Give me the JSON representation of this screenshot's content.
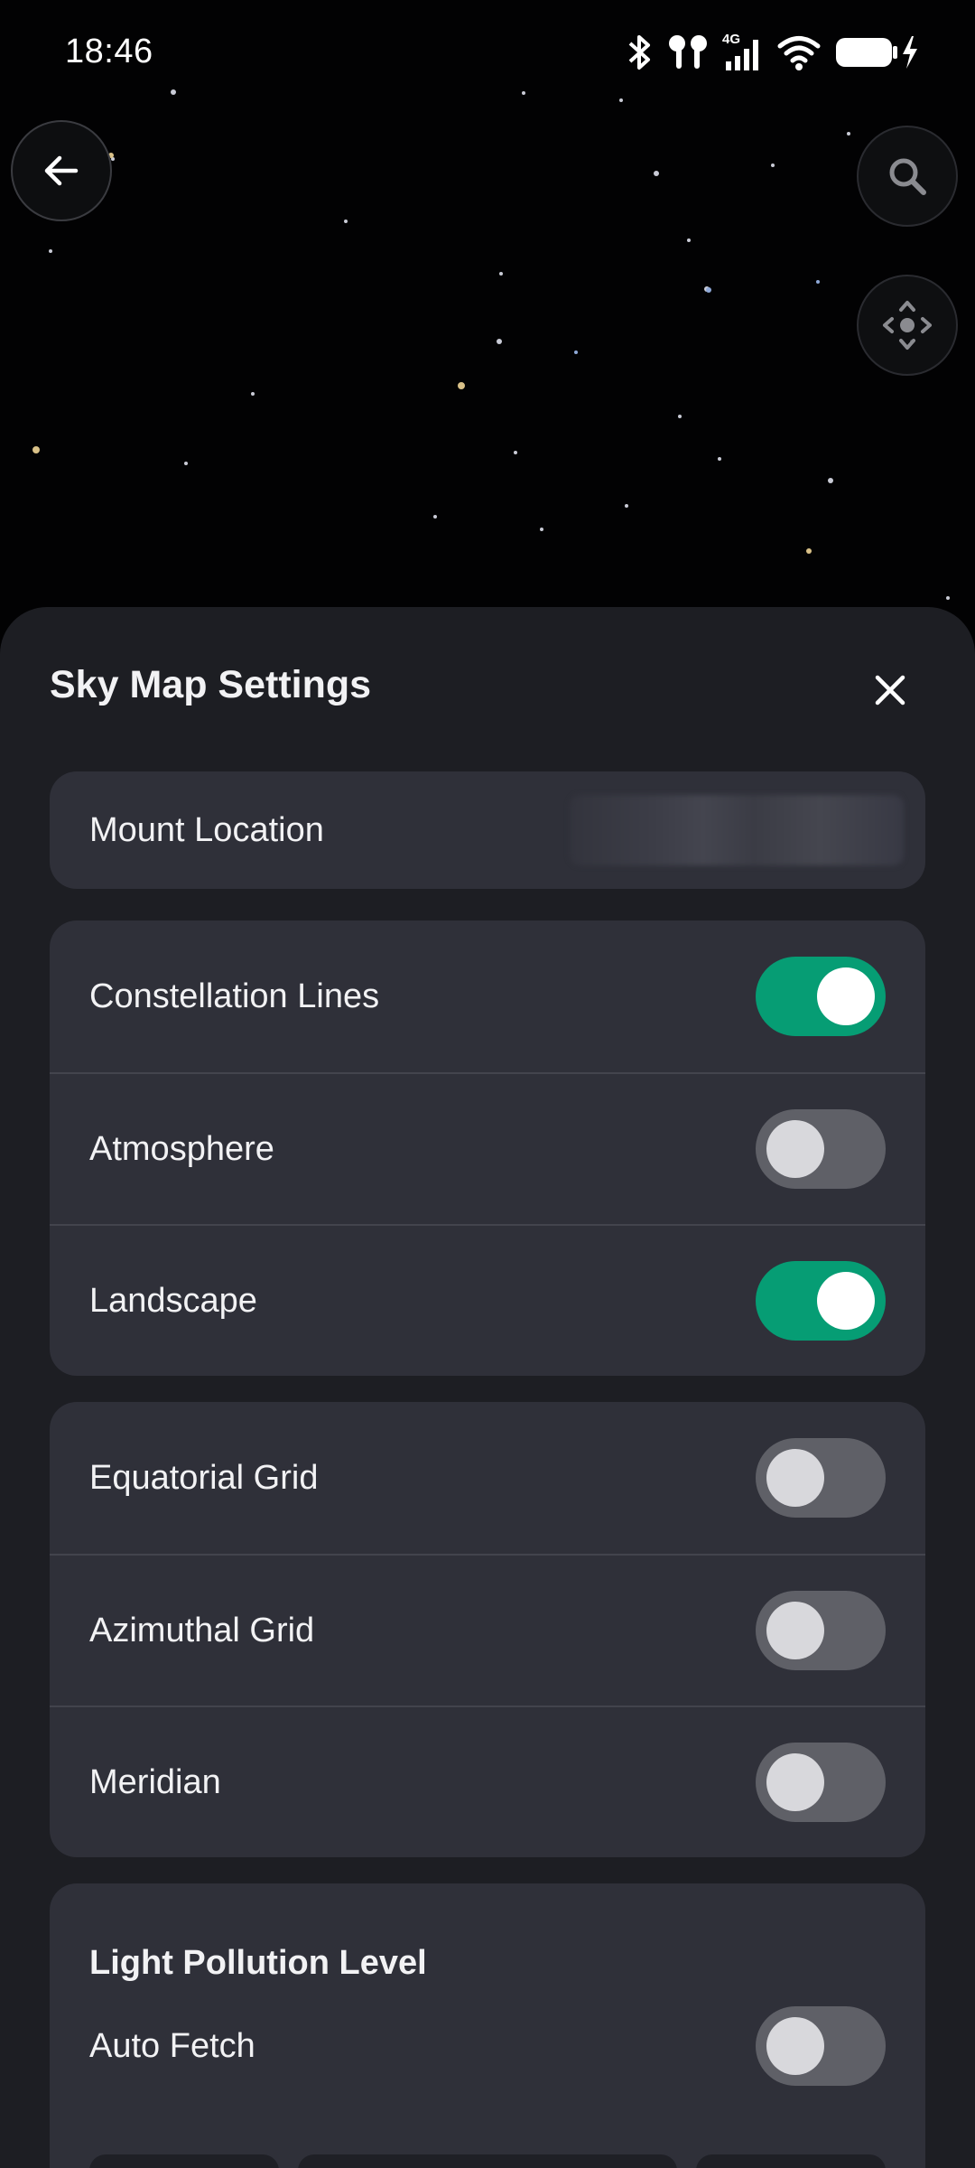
{
  "status_bar": {
    "time": "18:46",
    "icons": [
      "bluetooth-icon",
      "earbuds-icon",
      "signal-4g-icon",
      "wifi-icon",
      "battery-charging-icon"
    ],
    "network_label": "4G"
  },
  "map": {
    "icons": {
      "back": "arrow-left-icon",
      "search": "search-icon",
      "recenter": "recenter-icon"
    }
  },
  "sheet": {
    "title": "Sky Map Settings",
    "close_icon": "close-icon",
    "mount_location": {
      "label": "Mount Location"
    },
    "display_group": [
      {
        "label": "Constellation Lines",
        "on": true
      },
      {
        "label": "Atmosphere",
        "on": false
      },
      {
        "label": "Landscape",
        "on": true
      }
    ],
    "grid_group": [
      {
        "label": "Equatorial Grid",
        "on": false
      },
      {
        "label": "Azimuthal Grid",
        "on": false
      },
      {
        "label": "Meridian",
        "on": false
      }
    ],
    "light_pollution": {
      "title": "Light Pollution Level",
      "auto_fetch": {
        "label": "Auto Fetch",
        "on": false
      }
    }
  },
  "colors": {
    "accent_on": "#069d74",
    "toggle_off": "#5f6067",
    "sheet_bg": "#1d1e23",
    "card_bg": "#2f3039"
  }
}
